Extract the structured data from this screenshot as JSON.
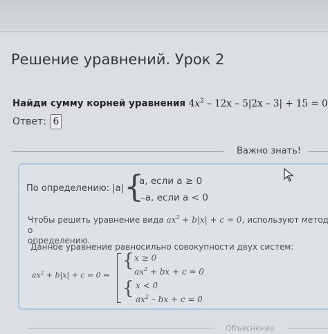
{
  "page": {
    "title": "Решение уравнений. Урок 2"
  },
  "task": {
    "prompt": "Найди сумму корней уравнения",
    "eq_a": "4",
    "eq_x": "x",
    "eq_pow": "2",
    "eq_rest": " – 12x – 5|2x – 3| + 15 = 0."
  },
  "answer": {
    "label": "Ответ:",
    "value": "6"
  },
  "section": {
    "important_label": "Важно знать!"
  },
  "definition": {
    "label": "По определению: |a| =",
    "case1": "a, если a ≥ 0",
    "case2": "–a, если a < 0"
  },
  "note": {
    "text1": "Чтобы решить уравнение вида ",
    "eq": "ax",
    "eq_pow": "2",
    "eq_rest": " + b|x| + c = 0",
    "text2": ", используют метод, о",
    "text3": "определению."
  },
  "equivalence": {
    "text": "Данное уравнение равносильно совокупности двух систем:"
  },
  "systems": {
    "lhs": "ax",
    "lhs_pow": "2",
    "lhs_rest": " + b|x| + c = 0 ⇔",
    "s1_cond": "x ≥ 0",
    "s1_eq": "ax",
    "s1_pow": "2",
    "s1_rest": " + bx + c = 0",
    "s2_cond": "x < 0",
    "s2_eq": "ax",
    "s2_pow": "2",
    "s2_rest": " – bx + c = 0"
  },
  "footer": {
    "faded_label": "Объяснение"
  },
  "colors": {
    "card_border": "#a9c7e4",
    "background": "#dcdfe2"
  }
}
